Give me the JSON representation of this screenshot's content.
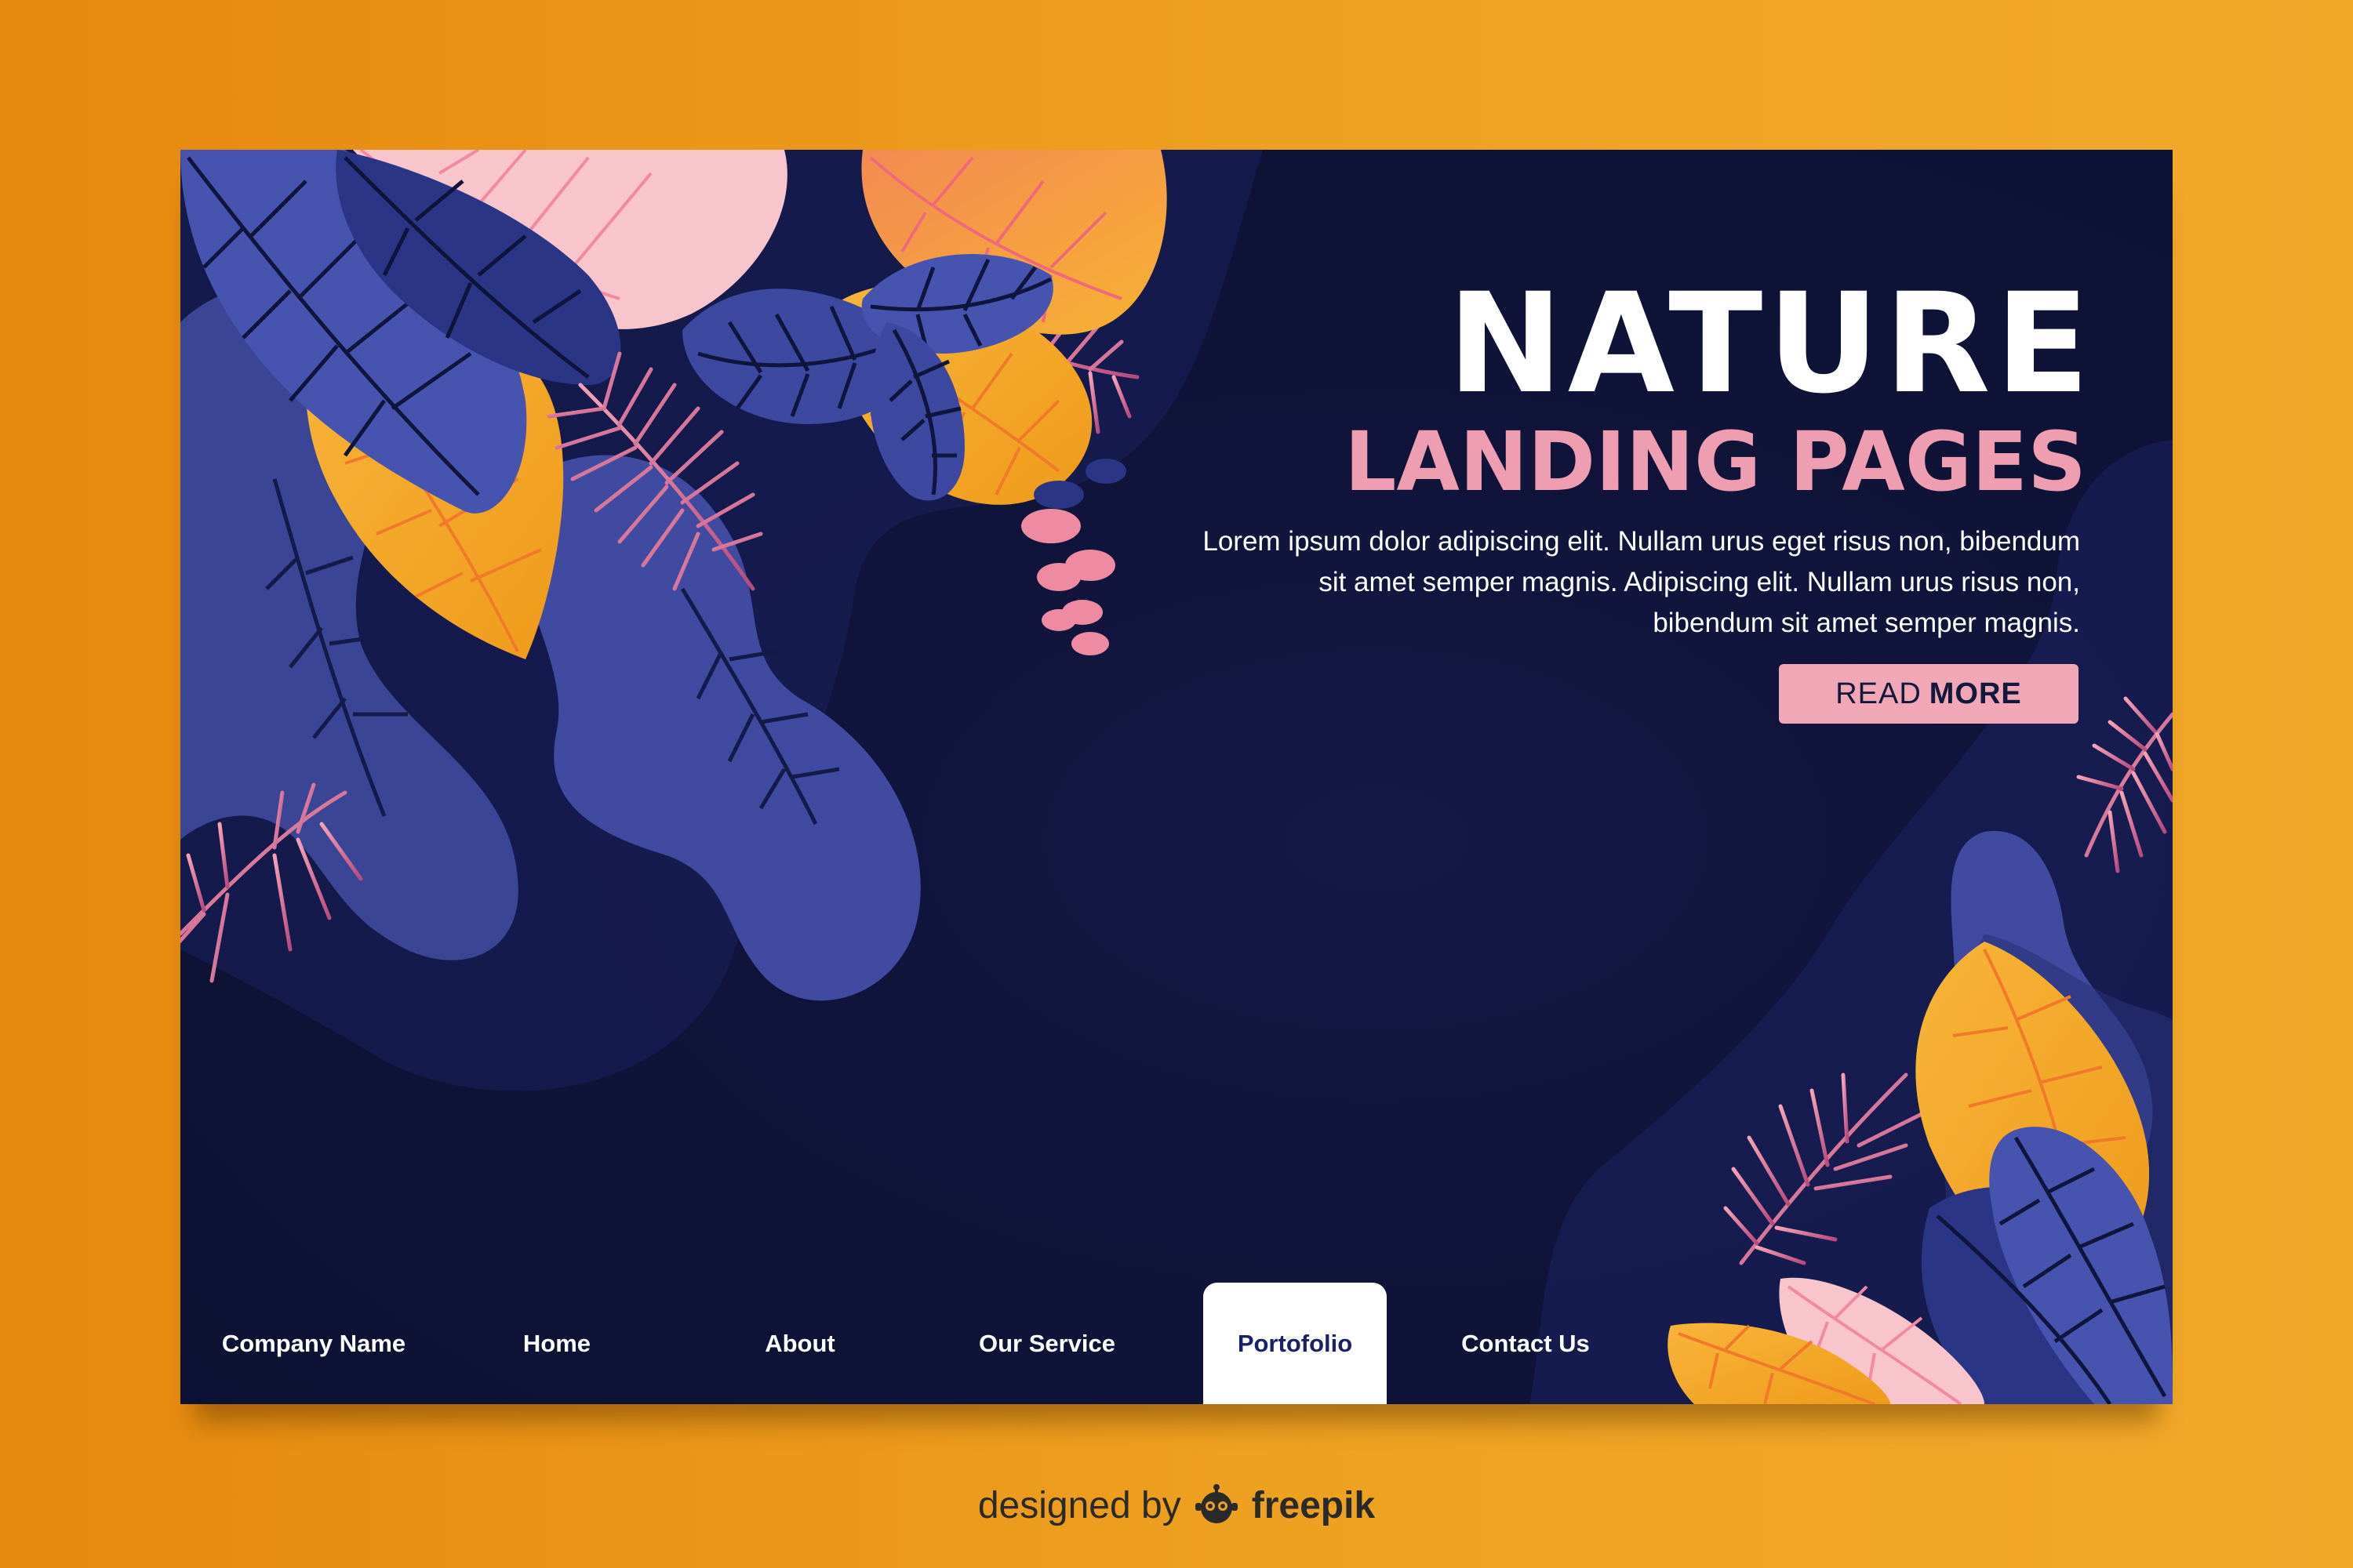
{
  "hero": {
    "title": "NATURE",
    "subtitle": "LANDING PAGES",
    "body": "Lorem ipsum dolor  adipiscing elit. Nullam urus eget risus non, bibendum sit amet semper magnis. Adipiscing elit. Nullam urus risus non, bibendum sit amet semper magnis.",
    "cta_light": "READ",
    "cta_bold": "MORE"
  },
  "nav": {
    "items": [
      {
        "label": "Company Name"
      },
      {
        "label": "Home"
      },
      {
        "label": "About"
      },
      {
        "label": "Our Service"
      },
      {
        "label": "Portofolio"
      },
      {
        "label": "Contact Us"
      }
    ],
    "active": "Portofolio"
  },
  "credit": {
    "prefix": "designed by",
    "brand": "freepik"
  },
  "colors": {
    "outer_background": "#eea121",
    "page_background": "#0f1338",
    "accent_pink": "#f2a7b6",
    "leaf_blue": "#3d4a9e",
    "leaf_orange": "#f5a31f",
    "leaf_pink": "#f8c5cd"
  },
  "icons": {
    "credit_logo": "freepik-robot-logo-icon"
  }
}
